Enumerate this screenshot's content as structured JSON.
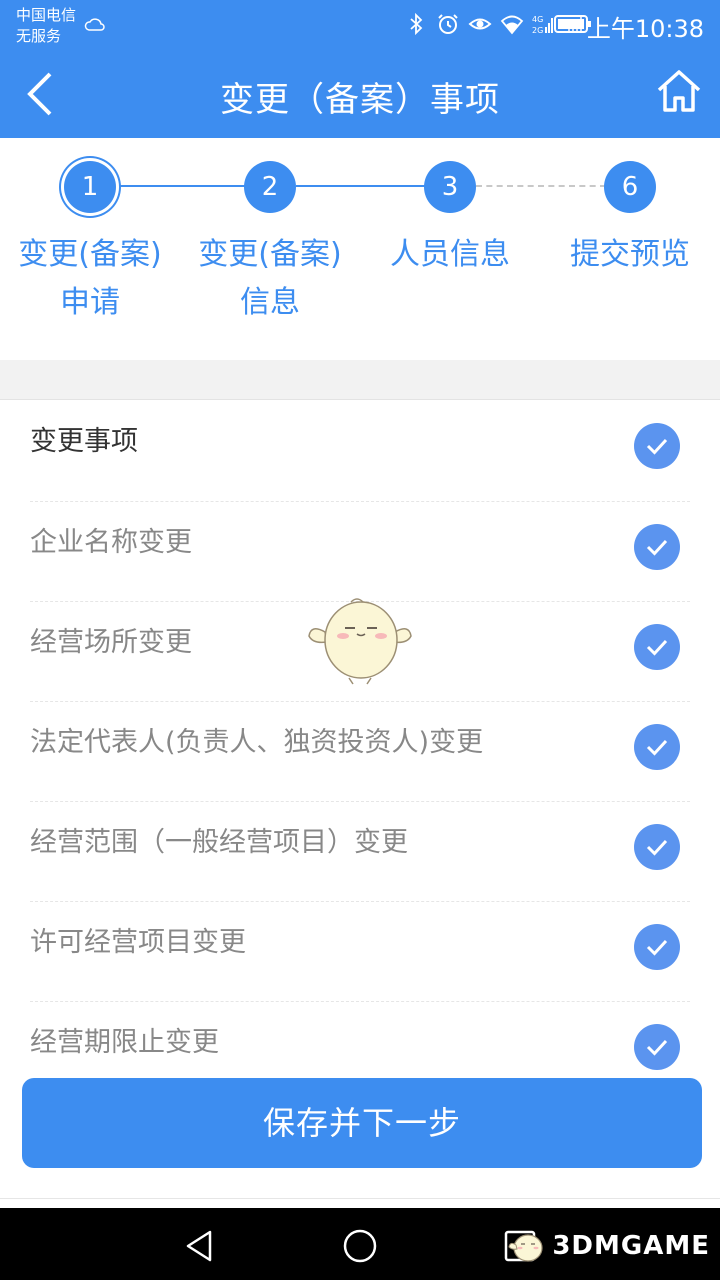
{
  "status_bar": {
    "carrier_line1": "中国电信",
    "carrier_line2": "无服务",
    "network": "4G 2G",
    "time": "上午10:38",
    "icons": [
      "cloud-icon",
      "bluetooth-icon",
      "alarm-icon",
      "eye-icon",
      "wifi-icon",
      "signal-icon",
      "battery-icon"
    ]
  },
  "header": {
    "title": "变更（备案）事项",
    "back_icon": "chevron-left-icon",
    "home_icon": "home-icon"
  },
  "stepper": {
    "steps": [
      {
        "number": "1",
        "label_line1": "变更(备案)",
        "label_line2": "申请",
        "state": "current"
      },
      {
        "number": "2",
        "label_line1": "变更(备案)",
        "label_line2": "信息",
        "state": "done"
      },
      {
        "number": "3",
        "label_line1": "人员信息",
        "label_line2": "",
        "state": "done"
      },
      {
        "number": "6",
        "label_line1": "提交预览",
        "label_line2": "",
        "state": "done"
      }
    ]
  },
  "list": {
    "header": "变更事项",
    "items": [
      {
        "label": "企业名称变更",
        "checked": true
      },
      {
        "label": "经营场所变更",
        "checked": true
      },
      {
        "label": "法定代表人(负责人、独资投资人)变更",
        "checked": true
      },
      {
        "label": "经营范围（一般经营项目）变更",
        "checked": true
      },
      {
        "label": "许可经营项目变更",
        "checked": true
      },
      {
        "label": "经营期限止变更",
        "checked": true
      }
    ]
  },
  "save_button": "保存并下一步",
  "watermark": "3DMGAME",
  "colors": {
    "primary": "#3d8df0",
    "check": "#5b94ef",
    "text_muted": "#888888",
    "text_dark": "#333333"
  }
}
